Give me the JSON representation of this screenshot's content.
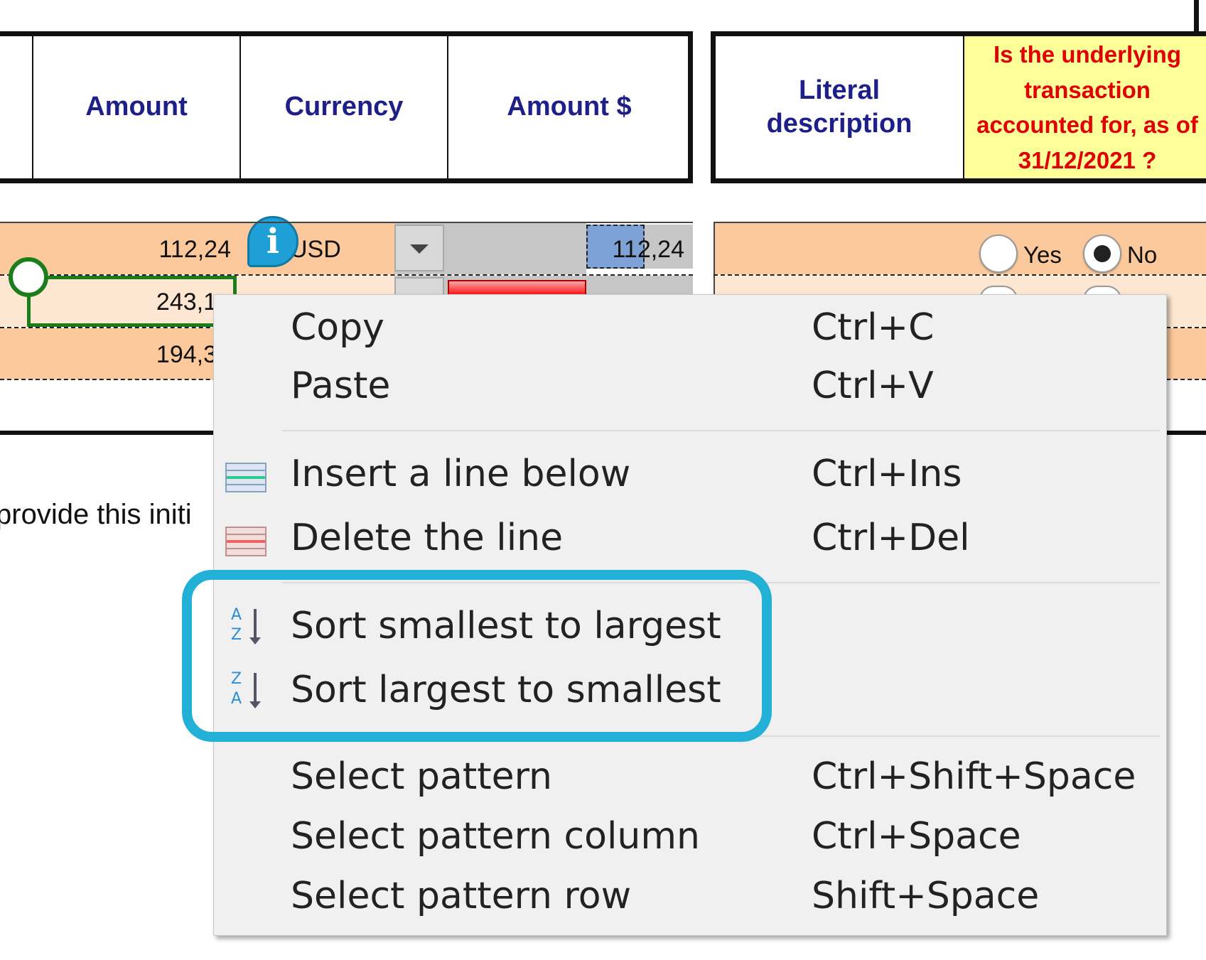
{
  "header_left": {
    "amount": "Amount",
    "currency": "Currency",
    "amount_usd": "Amount $"
  },
  "header_right": {
    "literal_description": "Literal description",
    "question": "Is the underlying transaction accounted for, as of 31/12/2021 ?"
  },
  "rows": [
    {
      "amount": "112,24",
      "currency": "USD",
      "amount_usd": "112,24"
    },
    {
      "amount": "243,1"
    },
    {
      "amount": "194,3"
    }
  ],
  "radio": {
    "yes": "Yes",
    "no": "No",
    "selected": "No"
  },
  "info_icon_glyph": "i",
  "body_text": "provide this initi",
  "colors": {
    "accent": "#23b0d6",
    "header_text": "#1f1f8a",
    "question_text": "#e00000",
    "row_orange": "#fbc99b"
  },
  "context_menu": {
    "copy": {
      "label": "Copy",
      "shortcut": "Ctrl+C"
    },
    "paste": {
      "label": "Paste",
      "shortcut": "Ctrl+V"
    },
    "insert_line": {
      "label": "Insert a line below",
      "shortcut": "Ctrl+Ins",
      "icon": "insert-row-icon"
    },
    "delete_line": {
      "label": "Delete the line",
      "shortcut": "Ctrl+Del",
      "icon": "delete-row-icon"
    },
    "sort_asc": {
      "label": "Sort smallest to largest",
      "icon": "sort-az-icon",
      "icon_top": "A",
      "icon_bottom": "Z"
    },
    "sort_desc": {
      "label": "Sort largest to smallest",
      "icon": "sort-za-icon",
      "icon_top": "Z",
      "icon_bottom": "A"
    },
    "select_pattern": {
      "label": "Select pattern",
      "shortcut": "Ctrl+Shift+Space"
    },
    "select_pattern_column": {
      "label": "Select pattern column",
      "shortcut": "Ctrl+Space"
    },
    "select_pattern_row": {
      "label": "Select pattern row",
      "shortcut": "Shift+Space"
    }
  }
}
